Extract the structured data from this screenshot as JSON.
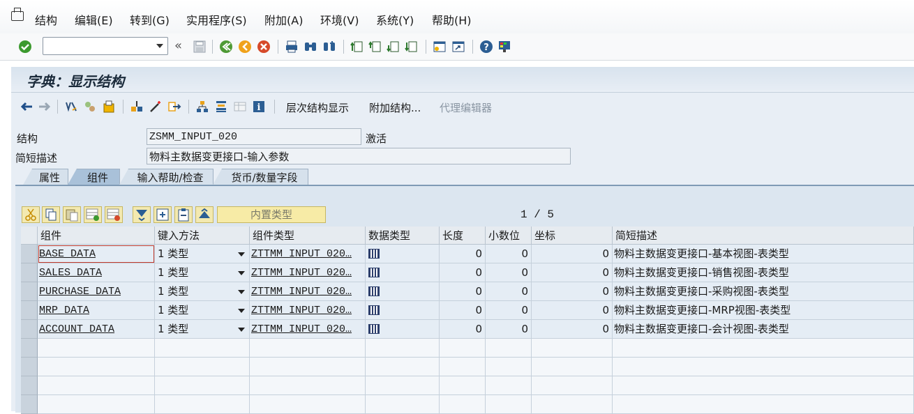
{
  "menu": [
    "结构",
    "编辑(E)",
    "转到(G)",
    "实用程序(S)",
    "附加(A)",
    "环境(V)",
    "系统(Y)",
    "帮助(H)"
  ],
  "title": "字典：显示结构",
  "app_toolbar": {
    "hierarchy": "层次结构显示",
    "append_structure": "附加结构...",
    "proxy_editor": "代理编辑器"
  },
  "header": {
    "structure_label": "结构",
    "structure_value": "ZSMM_INPUT_020",
    "status": "激活",
    "desc_label": "简短描述",
    "desc_value": "物料主数据变更接口-输入参数"
  },
  "tabs": [
    "属性",
    "组件",
    "输入帮助/检查",
    "货币/数量字段"
  ],
  "active_tab": "组件",
  "table_toolbar": {
    "builtin_type": "内置类型",
    "pager": "1 / 5"
  },
  "columns": [
    "组件",
    "键入方法",
    "组件类型",
    "数据类型",
    "长度",
    "小数位",
    "坐标",
    "简短描述"
  ],
  "rows": [
    {
      "component": "BASE_DATA",
      "typing": "1 类型",
      "comp_type": "ZTTMM_INPUT_020…",
      "length": "0",
      "decimals": "0",
      "coord": "0",
      "desc": "物料主数据变更接口-基本视图-表类型"
    },
    {
      "component": "SALES_DATA",
      "typing": "1 类型",
      "comp_type": "ZTTMM_INPUT_020…",
      "length": "0",
      "decimals": "0",
      "coord": "0",
      "desc": "物料主数据变更接口-销售视图-表类型"
    },
    {
      "component": "PURCHASE_DATA",
      "typing": "1 类型",
      "comp_type": "ZTTMM_INPUT_020…",
      "length": "0",
      "decimals": "0",
      "coord": "0",
      "desc": "物料主数据变更接口-采购视图-表类型"
    },
    {
      "component": "MRP_DATA",
      "typing": "1 类型",
      "comp_type": "ZTTMM_INPUT_020…",
      "length": "0",
      "decimals": "0",
      "coord": "0",
      "desc": "物料主数据变更接口-MRP视图-表类型"
    },
    {
      "component": "ACCOUNT_DATA",
      "typing": "1 类型",
      "comp_type": "ZTTMM_INPUT_020…",
      "length": "0",
      "decimals": "0",
      "coord": "0",
      "desc": "物料主数据变更接口-会计视图-表类型"
    }
  ]
}
